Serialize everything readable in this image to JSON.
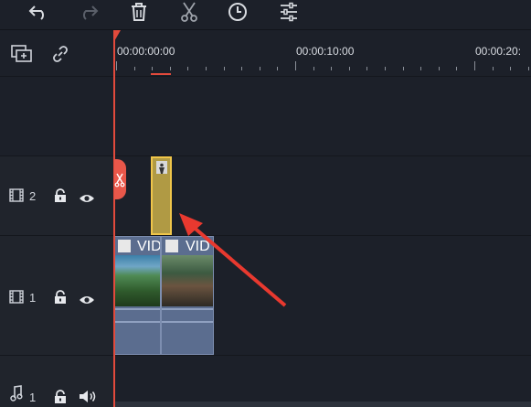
{
  "toolbar": {
    "icons": [
      "undo-icon",
      "redo-icon",
      "delete-icon",
      "scissors-icon",
      "clock-icon",
      "adjust-icon"
    ]
  },
  "ruler": {
    "times": [
      "00:00:00:00",
      "00:00:10:00",
      "00:00:20:"
    ]
  },
  "tracks": [
    {
      "type": "video",
      "number": "2"
    },
    {
      "type": "video",
      "number": "1"
    },
    {
      "type": "audio",
      "number": "1"
    }
  ],
  "clips": {
    "video1a_title": "VID",
    "video1b_title": "VID"
  },
  "colors": {
    "playhead": "#e24a3c",
    "track_bg": "#1c2029",
    "header_bg": "#20242c",
    "selected_clip": "#b09a44",
    "selected_border": "#f0c64a",
    "video_clip": "#5b6d8f",
    "arrow": "#e8392f"
  }
}
